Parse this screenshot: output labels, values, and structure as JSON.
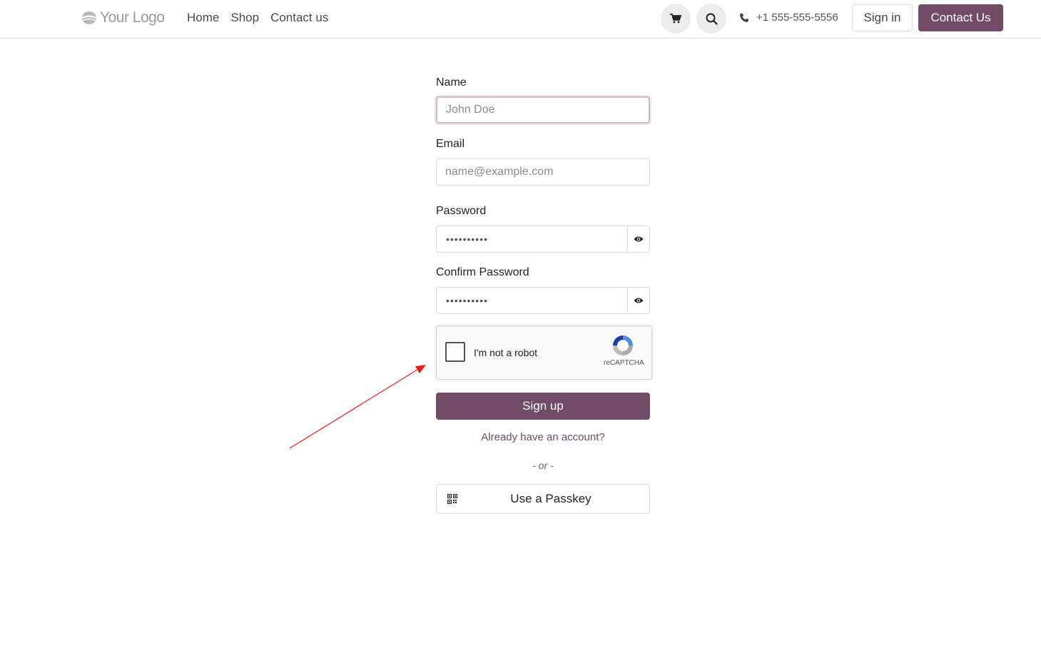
{
  "header": {
    "logo_text": "Your Logo",
    "nav": [
      "Home",
      "Shop",
      "Contact us"
    ],
    "cart_icon": "cart-icon",
    "search_icon": "search-icon",
    "phone": "+1 555-555-5556",
    "signin_label": "Sign in",
    "contact_label": "Contact Us",
    "accent_color": "#714b67"
  },
  "form": {
    "name_label": "Name",
    "name_placeholder": "John Doe",
    "email_label": "Email",
    "email_placeholder": "name@example.com",
    "password_label": "Password",
    "password_dots": "••••••••••",
    "confirm_label": "Confirm Password",
    "confirm_dots": "••••••••••",
    "captcha_text": "I'm not a robot",
    "captcha_brand": "reCAPTCHA",
    "signup_label": "Sign up",
    "already_label": "Already have an account?",
    "or_label": "- or -",
    "passkey_label": "Use a Passkey"
  }
}
